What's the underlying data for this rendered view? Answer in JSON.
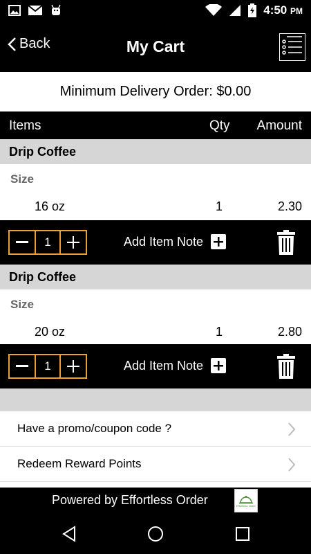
{
  "status_bar": {
    "time": "4:50",
    "ampm": "PM",
    "icons": [
      "image-icon",
      "gmail-icon",
      "android-icon",
      "wifi-icon",
      "signal-icon",
      "battery-charging-icon"
    ]
  },
  "header": {
    "back_label": "Back",
    "title": "My Cart",
    "menu_icon": "list-menu-icon"
  },
  "min_order": {
    "text": "Minimum Delivery Order: $0.00"
  },
  "columns": {
    "items": "Items",
    "qty": "Qty",
    "amount": "Amount"
  },
  "cart_items": [
    {
      "name": "Drip Coffee",
      "option_label": "Size",
      "option_value": "16 oz",
      "qty": "1",
      "amount": "2.30",
      "stepper_qty": "1",
      "note_label": "Add Item Note"
    },
    {
      "name": "Drip Coffee",
      "option_label": "Size",
      "option_value": "20 oz",
      "qty": "1",
      "amount": "2.80",
      "stepper_qty": "1",
      "note_label": "Add Item Note"
    }
  ],
  "links": [
    {
      "label": "Have a promo/coupon code ?"
    },
    {
      "label": "Redeem Reward Points"
    }
  ],
  "footer": {
    "powered_by": "Powered by Effortless Order",
    "logo_text": "Effortless Order"
  },
  "colors": {
    "accent": "#f0a030",
    "section_gray": "#d6d6d6",
    "bar": "#000000"
  }
}
